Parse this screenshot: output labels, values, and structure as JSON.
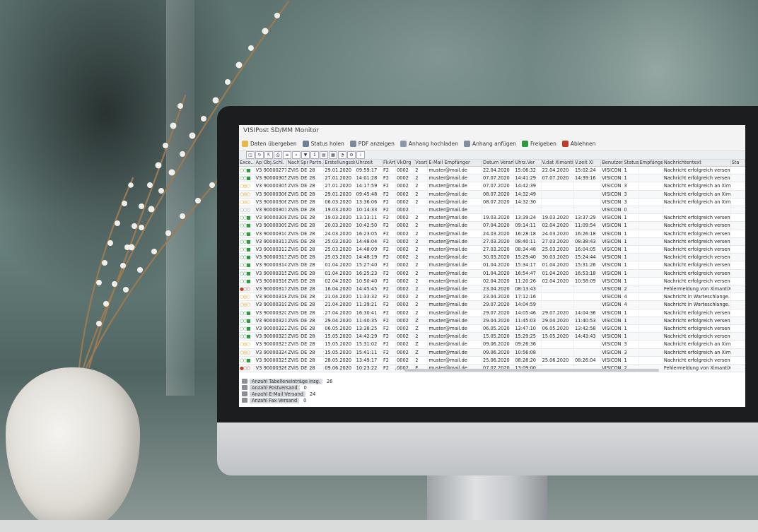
{
  "app": {
    "title": "VISIPost SD/MM Monitor"
  },
  "actions": [
    {
      "label": "Daten übergeben",
      "icon": "folder-export-icon",
      "color": "#e8b84a"
    },
    {
      "label": "Status holen",
      "icon": "printer-status-icon",
      "color": "#6e7f96"
    },
    {
      "label": "PDF anzeigen",
      "icon": "pdf-view-icon",
      "color": "#7a8a9a"
    },
    {
      "label": "Anhang hochladen",
      "icon": "upload-attachment-icon",
      "color": "#8a98a8"
    },
    {
      "label": "Anhang anfügen",
      "icon": "attach-icon",
      "color": "#8090a0"
    },
    {
      "label": "Freigeben",
      "icon": "green-flag-icon",
      "color": "#2e9a3e"
    },
    {
      "label": "Ablehnen",
      "icon": "reject-icon",
      "color": "#c23a2a"
    }
  ],
  "columns": [
    "Exce..",
    "Ap",
    "Obj.Schl.",
    "Nach",
    "Spr.",
    "Partn.",
    "Erstellungsdat.",
    "Uhrzeit",
    "FkArt",
    "VkOrg",
    "Vsart",
    "E-Mail Empfänger",
    "Datum Verarb.",
    "Uhrz.Ver",
    "V.dat XimantiX",
    "V.zeit XI",
    "Benutzer",
    "Status",
    "Empfänger",
    "Nachrichtentext",
    "Sta"
  ],
  "rows": [
    [
      "○○■",
      "V3",
      "90000277",
      "ZVIS",
      "DE",
      "28",
      "29.01.2020",
      "09:59:17",
      "F2",
      "0002",
      "2",
      "muster@mail.de",
      "22.04.2020",
      "15:06:32",
      "22.04.2020",
      "15:02:24",
      "VISICON",
      "1",
      "",
      "Nachricht erfolgreich versendet",
      ""
    ],
    [
      "○○■",
      "V3",
      "90000305",
      "ZVIS",
      "DE",
      "28",
      "27.01.2020",
      "14:01:28",
      "F2",
      "0002",
      "2",
      "muster@mail.de",
      "07.07.2020",
      "14:41:29",
      "07.07.2020",
      "14:39:16",
      "VISICON",
      "1",
      "",
      "Nachricht erfolgreich versendet",
      ""
    ],
    [
      "○◎○",
      "V3",
      "90000305",
      "ZVIS",
      "DE",
      "28",
      "27.01.2020",
      "14:17:59",
      "F2",
      "0002",
      "2",
      "muster@mail.de",
      "07.07.2020",
      "14:42:39",
      "",
      "",
      "VISICON",
      "3",
      "",
      "Nachricht erfolgreich an Xima...",
      ""
    ],
    [
      "○◎○",
      "V3",
      "90000306",
      "ZVIS",
      "DE",
      "28",
      "29.01.2020",
      "09:45:48",
      "F2",
      "0002",
      "2",
      "muster@mail.de",
      "08.07.2020",
      "14:32:49",
      "",
      "",
      "VISICON",
      "3",
      "",
      "Nachricht erfolgreich an Xima...",
      ""
    ],
    [
      "○◎○",
      "V3",
      "90000306",
      "ZVIS",
      "DE",
      "28",
      "06.03.2020",
      "13:36:06",
      "F2",
      "0002",
      "2",
      "muster@mail.de",
      "08.07.2020",
      "14:32:30",
      "",
      "",
      "VISICON",
      "3",
      "",
      "Nachricht erfolgreich an Xima...",
      ""
    ],
    [
      "○○○",
      "V3",
      "90000307",
      "ZVIS",
      "DE",
      "28",
      "19.03.2020",
      "10:14:33",
      "F2",
      "0002",
      "",
      "muster@mail.de",
      "",
      "",
      "",
      "",
      "VISICON",
      "0",
      "",
      "",
      ""
    ],
    [
      "○○■",
      "V3",
      "90000308",
      "ZVIS",
      "DE",
      "28",
      "19.03.2020",
      "13:13:11",
      "F2",
      "0002",
      "2",
      "muster@mail.de",
      "19.03.2020",
      "13:39:24",
      "19.03.2020",
      "13:37:29",
      "VISICON",
      "1",
      "",
      "Nachricht erfolgreich versendet",
      ""
    ],
    [
      "○○■",
      "V3",
      "90000309",
      "ZVIS",
      "DE",
      "28",
      "20.03.2020",
      "10:42:50",
      "F2",
      "0002",
      "2",
      "muster@mail.de",
      "07.04.2020",
      "09:14:11",
      "02.04.2020",
      "11:09:54",
      "VISICON",
      "1",
      "",
      "Nachricht erfolgreich versendet",
      ""
    ],
    [
      "○○■",
      "V3",
      "90000310",
      "ZVIS",
      "DE",
      "28",
      "24.03.2020",
      "16:23:05",
      "F2",
      "0002",
      "2",
      "muster@mail.de",
      "24.03.2020",
      "16:28:18",
      "24.03.2020",
      "16:26:18",
      "VISICON",
      "1",
      "",
      "Nachricht erfolgreich versendet",
      ""
    ],
    [
      "○○■",
      "V3",
      "90000311",
      "ZVIS",
      "DE",
      "28",
      "25.03.2020",
      "14:48:04",
      "F2",
      "0002",
      "2",
      "muster@mail.de",
      "27.03.2020",
      "08:40:11",
      "27.03.2020",
      "08:38:43",
      "VISICON",
      "1",
      "",
      "Nachricht erfolgreich versendet",
      ""
    ],
    [
      "○○■",
      "V3",
      "90000312",
      "ZVIS",
      "DE",
      "28",
      "25.03.2020",
      "14:48:09",
      "F2",
      "0002",
      "2",
      "muster@mail.de",
      "27.03.2020",
      "08:34:48",
      "25.03.2020",
      "16:04:05",
      "VISICON",
      "1",
      "",
      "Nachricht erfolgreich versendet",
      ""
    ],
    [
      "○○■",
      "V3",
      "90000313",
      "ZVIS",
      "DE",
      "28",
      "25.03.2020",
      "14:48:19",
      "F2",
      "0002",
      "2",
      "muster@mail.de",
      "30.03.2020",
      "15:29:40",
      "30.03.2020",
      "15:24:44",
      "VISICON",
      "1",
      "",
      "Nachricht erfolgreich versendet",
      ""
    ],
    [
      "○○■",
      "V3",
      "90000314",
      "ZVIS",
      "DE",
      "28",
      "01.04.2020",
      "15:27:40",
      "F2",
      "0002",
      "2",
      "muster@mail.de",
      "01.04.2020",
      "15:34:17",
      "01.04.2020",
      "15:31:26",
      "VISICON",
      "1",
      "",
      "Nachricht erfolgreich versendet",
      ""
    ],
    [
      "○○■",
      "V3",
      "90000315",
      "ZVIS",
      "DE",
      "28",
      "01.04.2020",
      "16:25:23",
      "F2",
      "0002",
      "2",
      "muster@mail.de",
      "01.04.2020",
      "16:54:47",
      "01.04.2020",
      "16:53:18",
      "VISICON",
      "1",
      "",
      "Nachricht erfolgreich versendet",
      ""
    ],
    [
      "○○■",
      "V3",
      "90000316",
      "ZVIS",
      "DE",
      "28",
      "02.04.2020",
      "10:50:40",
      "F2",
      "0002",
      "2",
      "muster@mail.de",
      "02.04.2020",
      "11:20:26",
      "02.04.2020",
      "10:58:09",
      "VISICON",
      "1",
      "",
      "Nachricht erfolgreich versendet",
      ""
    ],
    [
      "●○○",
      "V3",
      "90000317",
      "ZVIS",
      "DE",
      "28",
      "16.04.2020",
      "14:45:45",
      "F2",
      "0002",
      "2",
      "muster@mail.de",
      "23.04.2020",
      "08:13:43",
      "",
      "",
      "VISICON",
      "2",
      "",
      "Fehlermeldung von XimantiX, ...",
      ""
    ],
    [
      "○◎○",
      "V3",
      "90000318",
      "ZVIS",
      "DE",
      "28",
      "21.04.2020",
      "11:33:32",
      "F2",
      "0002",
      "2",
      "muster@mail.de",
      "23.04.2020",
      "17:12:16",
      "",
      "",
      "VISICON",
      "4",
      "",
      "Nachricht in Warteschlange. ...",
      ""
    ],
    [
      "○◎○",
      "V3",
      "90000319",
      "ZVIS",
      "DE",
      "28",
      "21.04.2020",
      "11:39:21",
      "F2",
      "0002",
      "2",
      "muster@mail.de",
      "29.07.2020",
      "14:04:59",
      "",
      "",
      "VISICON",
      "4",
      "",
      "Nachricht in Warteschlange. ...",
      ""
    ],
    [
      "○○■",
      "V3",
      "90000320",
      "ZVIS",
      "DE",
      "28",
      "27.04.2020",
      "16:30:41",
      "F2",
      "0002",
      "2",
      "muster@mail.de",
      "29.07.2020",
      "14:05:46",
      "29.07.2020",
      "14:04:36",
      "VISICON",
      "1",
      "",
      "Nachricht erfolgreich versendet",
      ""
    ],
    [
      "○○■",
      "V3",
      "90000321",
      "ZVIS",
      "DE",
      "28",
      "29.04.2020",
      "11:40:35",
      "F2",
      "0002",
      "Z",
      "muster@mail.de",
      "29.04.2020",
      "11:45:03",
      "29.04.2020",
      "11:40:53",
      "VISICON",
      "1",
      "",
      "Nachricht erfolgreich versendet",
      ""
    ],
    [
      "○○■",
      "V3",
      "90000322",
      "ZVIS",
      "DE",
      "28",
      "06.05.2020",
      "13:38:25",
      "F2",
      "0002",
      "Z",
      "muster@mail.de",
      "06.05.2020",
      "13:47:10",
      "06.05.2020",
      "13:42:58",
      "VISICON",
      "1",
      "",
      "Nachricht erfolgreich versendet",
      ""
    ],
    [
      "○○■",
      "V3",
      "90000323",
      "ZVIS",
      "DE",
      "28",
      "15.05.2020",
      "14:42:29",
      "F2",
      "0002",
      "2",
      "muster@mail.de",
      "15.05.2020",
      "15:29:25",
      "15.05.2020",
      "14:43:43",
      "VISICON",
      "1",
      "",
      "Nachricht erfolgreich versendet",
      ""
    ],
    [
      "○◎○",
      "V3",
      "90000323",
      "ZVIS",
      "DE",
      "28",
      "15.05.2020",
      "15:31:02",
      "F2",
      "0002",
      "Z",
      "muster@mail.de",
      "09.06.2020",
      "09:26:36",
      "",
      "",
      "VISICON",
      "3",
      "",
      "Nachricht erfolgreich an Xima...",
      ""
    ],
    [
      "○◎○",
      "V3",
      "90000324",
      "ZVIS",
      "DE",
      "28",
      "15.05.2020",
      "15:41:11",
      "F2",
      "0002",
      "Z",
      "muster@mail.de",
      "09.06.2020",
      "10:56:08",
      "",
      "",
      "VISICON",
      "3",
      "",
      "Nachricht erfolgreich an Xima...",
      ""
    ],
    [
      "○○■",
      "V3",
      "90000325",
      "ZVIS",
      "DE",
      "28",
      "28.05.2020",
      "13:49:17",
      "F2",
      "0002",
      "2",
      "muster@mail.de",
      "25.06.2020",
      "08:28:20",
      "25.06.2020",
      "08:26:04",
      "VISICON",
      "1",
      "",
      "Nachricht erfolgreich versendet",
      ""
    ],
    [
      "●○○",
      "V3",
      "90000326",
      "ZVIS",
      "DE",
      "28",
      "09.06.2020",
      "10:23:22",
      "F2",
      "0002",
      "E",
      "muster@mail.de",
      "07.07.2020",
      "13:09:00",
      "",
      "",
      "VISICON",
      "2",
      "",
      "Fehlermeldung von XimantiX, ...",
      ""
    ]
  ],
  "summary": [
    {
      "label": "Anzahl Tabelleneinträge insg.",
      "value": "26"
    },
    {
      "label": "Anzahl Postversand",
      "value": "0"
    },
    {
      "label": "Anzahl E-Mail Versand",
      "value": "24"
    },
    {
      "label": "Anzahl Fax Versand",
      "value": "0"
    }
  ],
  "colors": {
    "ok": "#2e9a3e",
    "warn": "#e0a020",
    "error": "#c23a2a",
    "idle": "#9aa0a6"
  }
}
